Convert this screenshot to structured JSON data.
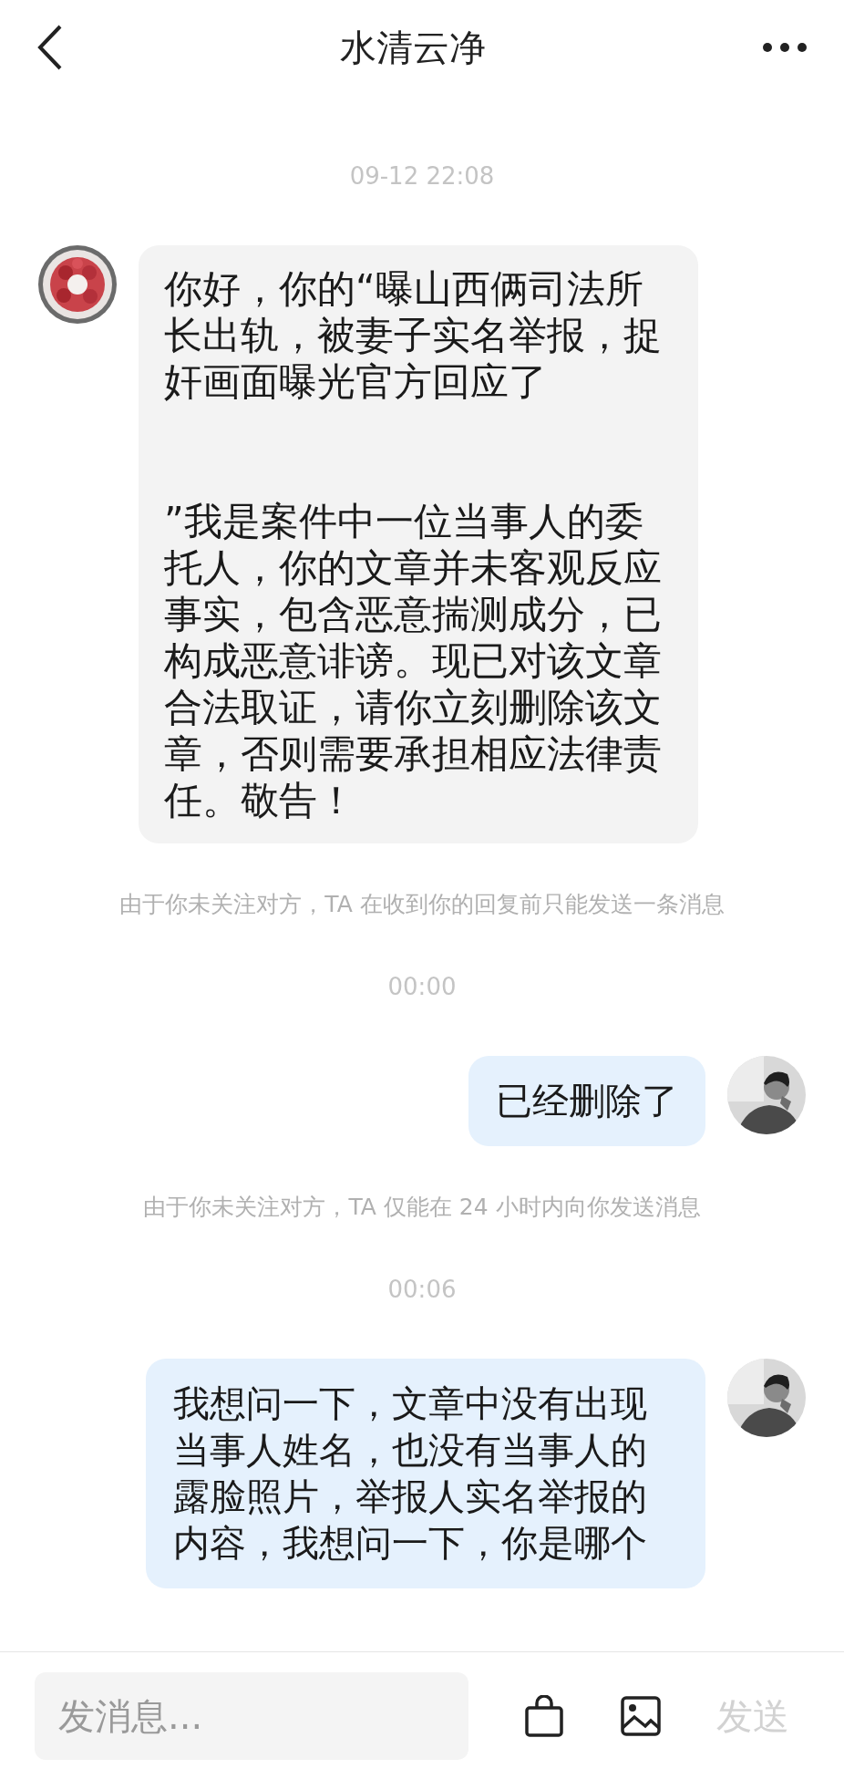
{
  "header": {
    "title": "水清云净"
  },
  "messages": [
    {
      "kind": "time",
      "text": "09-12 22:08"
    },
    {
      "kind": "incoming",
      "text": "你好，你的“曝山西俩司法所长出轨，被妻子实名举报，捉奸画面曝光官方回应了\n\n\n”我是案件中一位当事人的委托人，你的文章并未客观反应事实，包含恶意揣测成分，已构成恶意诽谤。现已对该文章合法取证，请你立刻删除该文章，否则需要承担相应法律责任。敬告！"
    },
    {
      "kind": "notice",
      "text": "由于你未关注对方，TA 在收到你的回复前只能发送一条消息"
    },
    {
      "kind": "time",
      "text": "00:00"
    },
    {
      "kind": "outgoing",
      "text": "已经删除了"
    },
    {
      "kind": "notice",
      "text": "由于你未关注对方，TA 仅能在 24 小时内向你发送消息"
    },
    {
      "kind": "time",
      "text": "00:06"
    },
    {
      "kind": "outgoing",
      "text": "我想问一下，文章中没有出现当事人姓名，也没有当事人的露脸照片，举报人实名举报的内容，我想问一下，你是哪个"
    }
  ],
  "composer": {
    "placeholder": "发消息...",
    "send": "发送",
    "send_disabled": true
  }
}
